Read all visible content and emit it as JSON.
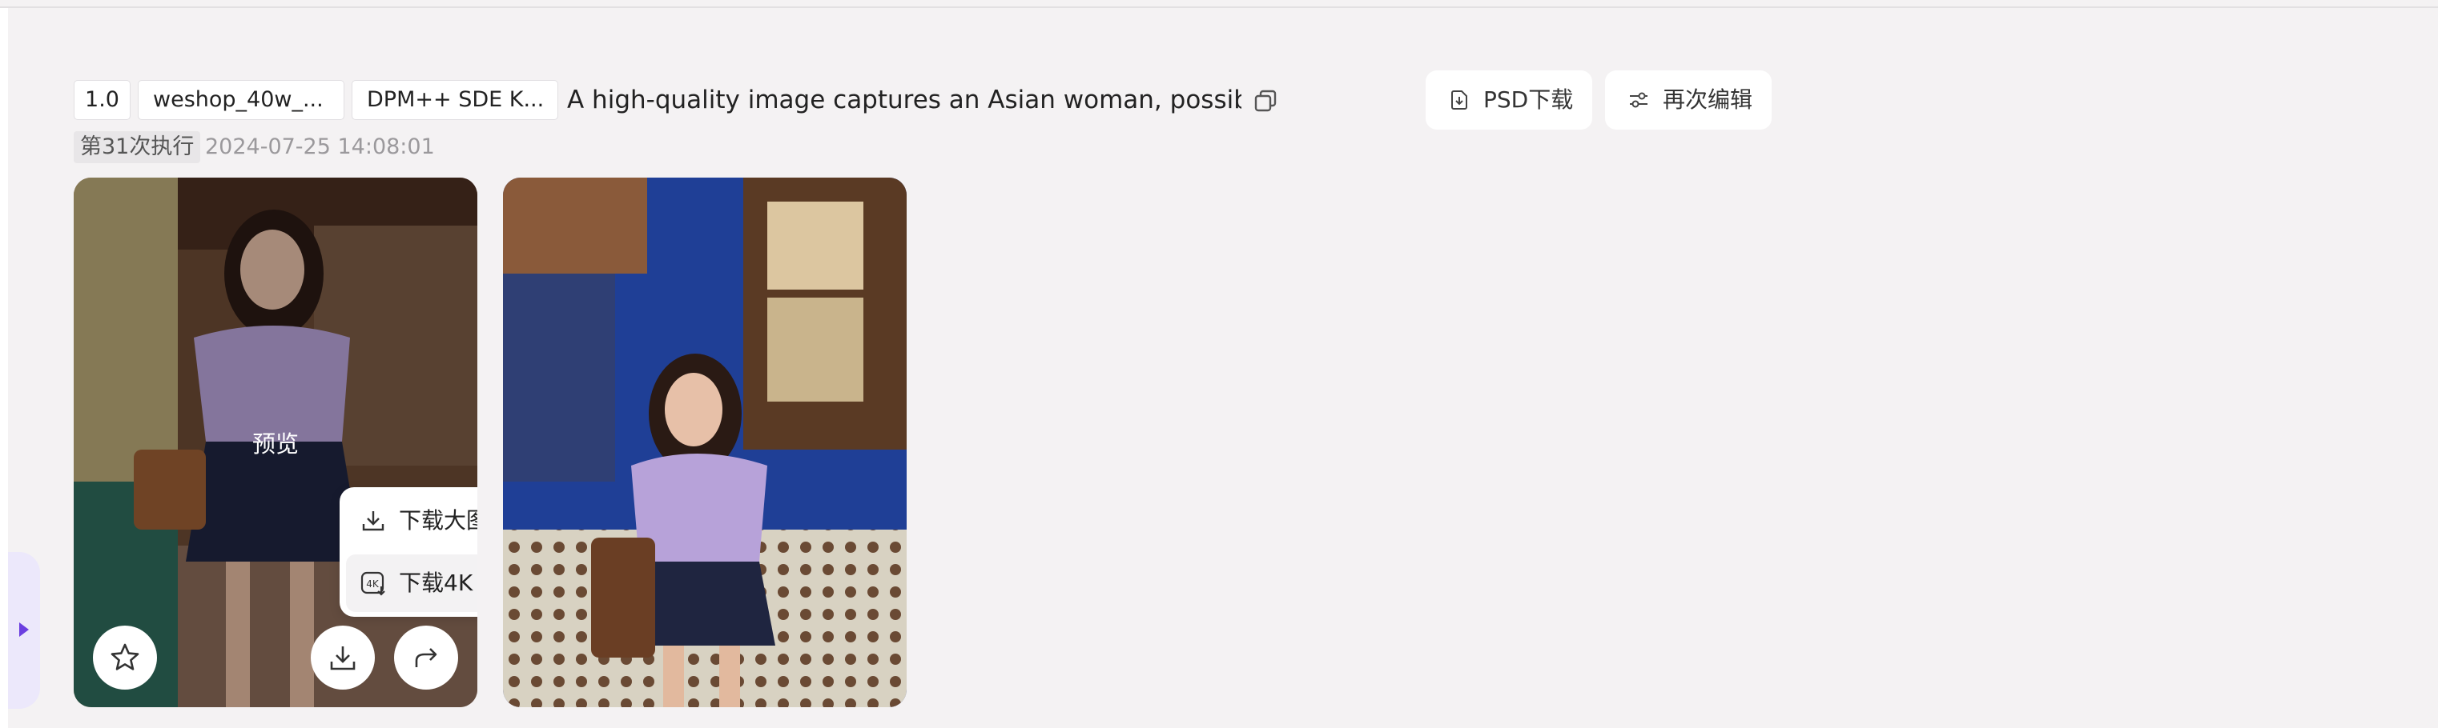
{
  "params": {
    "ratio": "1.0",
    "model": "weshop_40w_...",
    "sampler": "DPM++ SDE K...",
    "prompt": "A high-quality image captures an Asian woman, possibly"
  },
  "actions": {
    "psd_download": "PSD下载",
    "re_edit": "再次编辑"
  },
  "run": {
    "badge": "第31次执行",
    "timestamp": "2024-07-25 14:08:01"
  },
  "image_card": {
    "preview_label": "预览",
    "download_menu": {
      "download_large": "下载大图",
      "download_4k": "下载4K"
    }
  },
  "icons": {
    "copy": "copy-icon",
    "psd": "psd-download-icon",
    "reedit": "sliders-icon",
    "star": "star-icon",
    "download": "download-icon",
    "share": "share-icon",
    "sidebar": "expand-arrow-icon"
  },
  "colors": {
    "accent": "#6b3fe0",
    "background": "#f4f2f3"
  }
}
